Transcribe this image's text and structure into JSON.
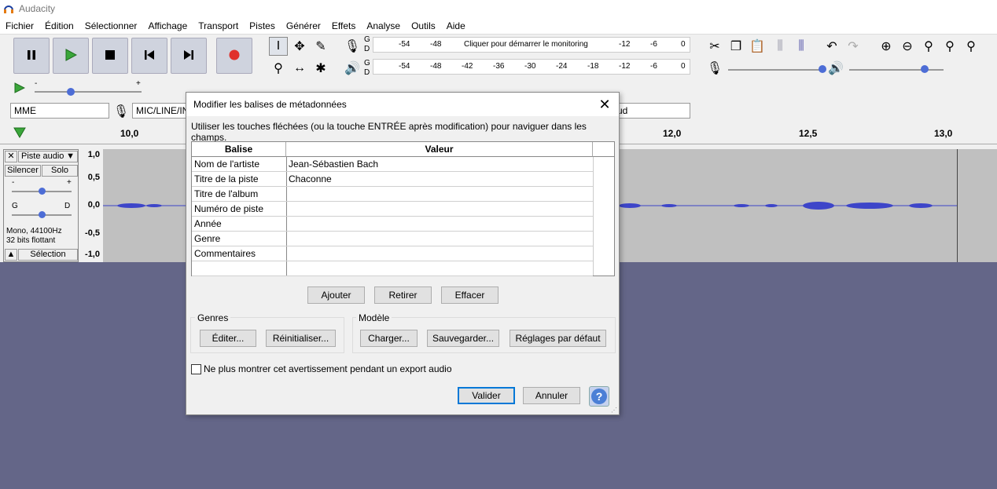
{
  "app": {
    "title": "Audacity"
  },
  "menu": [
    "Fichier",
    "Édition",
    "Sélectionner",
    "Affichage",
    "Transport",
    "Pistes",
    "Générer",
    "Effets",
    "Analyse",
    "Outils",
    "Aide"
  ],
  "meters": {
    "record_letters": [
      "G",
      "D"
    ],
    "record_ticks": [
      "-54",
      "-48",
      "Cliquer pour démarrer le monitoring",
      "-12",
      "-6",
      "0"
    ],
    "play_ticks": [
      "-54",
      "-48",
      "-42",
      "-36",
      "-30",
      "-24",
      "-18",
      "-12",
      "-6",
      "0"
    ]
  },
  "play_speed": {
    "minus": "-",
    "plus": "+"
  },
  "devices": {
    "host": "MME",
    "input": "MIC/LINE/IN",
    "output": "ud"
  },
  "timeline": {
    "labels": [
      "10,0",
      "12,0",
      "12,5",
      "13,0"
    ]
  },
  "track": {
    "name": "Piste audio",
    "mute": "Silencer",
    "solo": "Solo",
    "gain_minus": "-",
    "gain_plus": "+",
    "pan_left": "G",
    "pan_right": "D",
    "info_line1": "Mono, 44100Hz",
    "info_line2": "32 bits flottant",
    "select": "Sélection",
    "scale": [
      "1,0",
      "0,5",
      "0,0",
      "-0,5",
      "-1,0"
    ]
  },
  "dialog": {
    "title": "Modifier les balises de métadonnées",
    "instruction": "Utiliser les touches fléchées (ou la touche ENTRÉE après modification) pour naviguer dans les champs.",
    "columns": {
      "tag": "Balise",
      "value": "Valeur"
    },
    "rows": [
      {
        "tag": "Nom de l'artiste",
        "value": "Jean-Sébastien Bach"
      },
      {
        "tag": "Titre de la piste",
        "value": "Chaconne"
      },
      {
        "tag": "Titre de l'album",
        "value": ""
      },
      {
        "tag": "Numéro de piste",
        "value": ""
      },
      {
        "tag": "Année",
        "value": ""
      },
      {
        "tag": "Genre",
        "value": ""
      },
      {
        "tag": "Commentaires",
        "value": ""
      },
      {
        "tag": "",
        "value": ""
      }
    ],
    "buttons": {
      "add": "Ajouter",
      "remove": "Retirer",
      "clear": "Effacer"
    },
    "genres": {
      "label": "Genres",
      "edit": "Éditer...",
      "reset": "Réinitialiser..."
    },
    "template": {
      "label": "Modèle",
      "load": "Charger...",
      "save": "Sauvegarder...",
      "defaults": "Réglages par défaut"
    },
    "checkbox": "Ne plus montrer cet avertissement pendant un export audio",
    "ok": "Valider",
    "cancel": "Annuler",
    "help": "?"
  },
  "colors": {
    "background": "#646688",
    "wave": "#3d45c9",
    "record": "#e0302c",
    "play": "#3aa63a"
  }
}
